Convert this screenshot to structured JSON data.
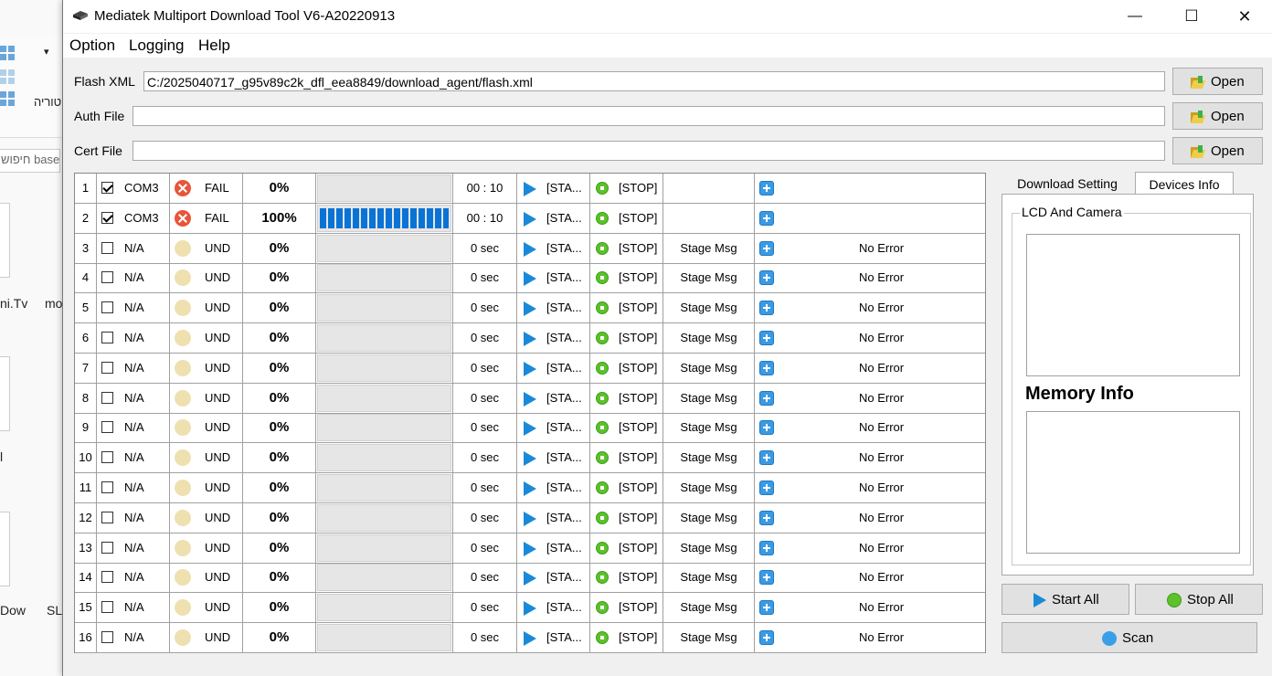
{
  "background": {
    "ribbon_text": "טוריה",
    "search_text": "חיפוש base",
    "file_labels": [
      "ni.Tv",
      "mo",
      "l",
      "Dow",
      "SL"
    ]
  },
  "window": {
    "title": "Mediatek Multiport Download Tool V6-A20220913",
    "minimize": "—",
    "maximize": "☐",
    "close": "✕"
  },
  "menu": [
    "Option",
    "Logging",
    "Help"
  ],
  "files": {
    "flash_label": "Flash XML",
    "flash_value": "C:/2025040717_g95v89c2k_dfl_eea8849/download_agent/flash.xml",
    "auth_label": "Auth File",
    "auth_value": "",
    "cert_label": "Cert File",
    "cert_value": "",
    "open_label": "Open"
  },
  "ports": [
    {
      "num": "1",
      "checked": true,
      "port": "COM3",
      "status": "FAIL",
      "status_type": "fail",
      "percent": "0%",
      "progress": 0,
      "time": "00 : 10",
      "start": "[STA...",
      "stop": "[STOP]",
      "stage": "",
      "error": ""
    },
    {
      "num": "2",
      "checked": true,
      "port": "COM3",
      "status": "FAIL",
      "status_type": "fail",
      "percent": "100%",
      "progress": 1,
      "time": "00 : 10",
      "start": "[STA...",
      "stop": "[STOP]",
      "stage": "",
      "error": ""
    },
    {
      "num": "3",
      "checked": false,
      "port": "N/A",
      "status": "UND",
      "status_type": "und",
      "percent": "0%",
      "progress": 0,
      "time": "0 sec",
      "start": "[STA...",
      "stop": "[STOP]",
      "stage": "Stage Msg",
      "error": "No Error"
    },
    {
      "num": "4",
      "checked": false,
      "port": "N/A",
      "status": "UND",
      "status_type": "und",
      "percent": "0%",
      "progress": 0,
      "time": "0 sec",
      "start": "[STA...",
      "stop": "[STOP]",
      "stage": "Stage Msg",
      "error": "No Error"
    },
    {
      "num": "5",
      "checked": false,
      "port": "N/A",
      "status": "UND",
      "status_type": "und",
      "percent": "0%",
      "progress": 0,
      "time": "0 sec",
      "start": "[STA...",
      "stop": "[STOP]",
      "stage": "Stage Msg",
      "error": "No Error"
    },
    {
      "num": "6",
      "checked": false,
      "port": "N/A",
      "status": "UND",
      "status_type": "und",
      "percent": "0%",
      "progress": 0,
      "time": "0 sec",
      "start": "[STA...",
      "stop": "[STOP]",
      "stage": "Stage Msg",
      "error": "No Error"
    },
    {
      "num": "7",
      "checked": false,
      "port": "N/A",
      "status": "UND",
      "status_type": "und",
      "percent": "0%",
      "progress": 0,
      "time": "0 sec",
      "start": "[STA...",
      "stop": "[STOP]",
      "stage": "Stage Msg",
      "error": "No Error"
    },
    {
      "num": "8",
      "checked": false,
      "port": "N/A",
      "status": "UND",
      "status_type": "und",
      "percent": "0%",
      "progress": 0,
      "time": "0 sec",
      "start": "[STA...",
      "stop": "[STOP]",
      "stage": "Stage Msg",
      "error": "No Error"
    },
    {
      "num": "9",
      "checked": false,
      "port": "N/A",
      "status": "UND",
      "status_type": "und",
      "percent": "0%",
      "progress": 0,
      "time": "0 sec",
      "start": "[STA...",
      "stop": "[STOP]",
      "stage": "Stage Msg",
      "error": "No Error"
    },
    {
      "num": "10",
      "checked": false,
      "port": "N/A",
      "status": "UND",
      "status_type": "und",
      "percent": "0%",
      "progress": 0,
      "time": "0 sec",
      "start": "[STA...",
      "stop": "[STOP]",
      "stage": "Stage Msg",
      "error": "No Error"
    },
    {
      "num": "11",
      "checked": false,
      "port": "N/A",
      "status": "UND",
      "status_type": "und",
      "percent": "0%",
      "progress": 0,
      "time": "0 sec",
      "start": "[STA...",
      "stop": "[STOP]",
      "stage": "Stage Msg",
      "error": "No Error"
    },
    {
      "num": "12",
      "checked": false,
      "port": "N/A",
      "status": "UND",
      "status_type": "und",
      "percent": "0%",
      "progress": 0,
      "time": "0 sec",
      "start": "[STA...",
      "stop": "[STOP]",
      "stage": "Stage Msg",
      "error": "No Error"
    },
    {
      "num": "13",
      "checked": false,
      "port": "N/A",
      "status": "UND",
      "status_type": "und",
      "percent": "0%",
      "progress": 0,
      "time": "0 sec",
      "start": "[STA...",
      "stop": "[STOP]",
      "stage": "Stage Msg",
      "error": "No Error"
    },
    {
      "num": "14",
      "checked": false,
      "port": "N/A",
      "status": "UND",
      "status_type": "und",
      "percent": "0%",
      "progress": 0,
      "time": "0 sec",
      "start": "[STA...",
      "stop": "[STOP]",
      "stage": "Stage Msg",
      "error": "No Error"
    },
    {
      "num": "15",
      "checked": false,
      "port": "N/A",
      "status": "UND",
      "status_type": "und",
      "percent": "0%",
      "progress": 0,
      "time": "0 sec",
      "start": "[STA...",
      "stop": "[STOP]",
      "stage": "Stage Msg",
      "error": "No Error"
    },
    {
      "num": "16",
      "checked": false,
      "port": "N/A",
      "status": "UND",
      "status_type": "und",
      "percent": "0%",
      "progress": 0,
      "time": "0 sec",
      "start": "[STA...",
      "stop": "[STOP]",
      "stage": "Stage Msg",
      "error": "No Error"
    }
  ],
  "side": {
    "tab_download": "Download Setting",
    "tab_devices": "Devices Info",
    "group_label": "LCD And Camera",
    "memory_label": "Memory Info",
    "start_all": "Start All",
    "stop_all": "Stop All",
    "scan": "Scan"
  },
  "colors": {
    "progress": "#0a73d6",
    "fail": "#e8553a",
    "und": "#efe0b0",
    "play": "#1a8ad8",
    "stop": "#5cc12b",
    "plus": "#3a9ae4"
  }
}
